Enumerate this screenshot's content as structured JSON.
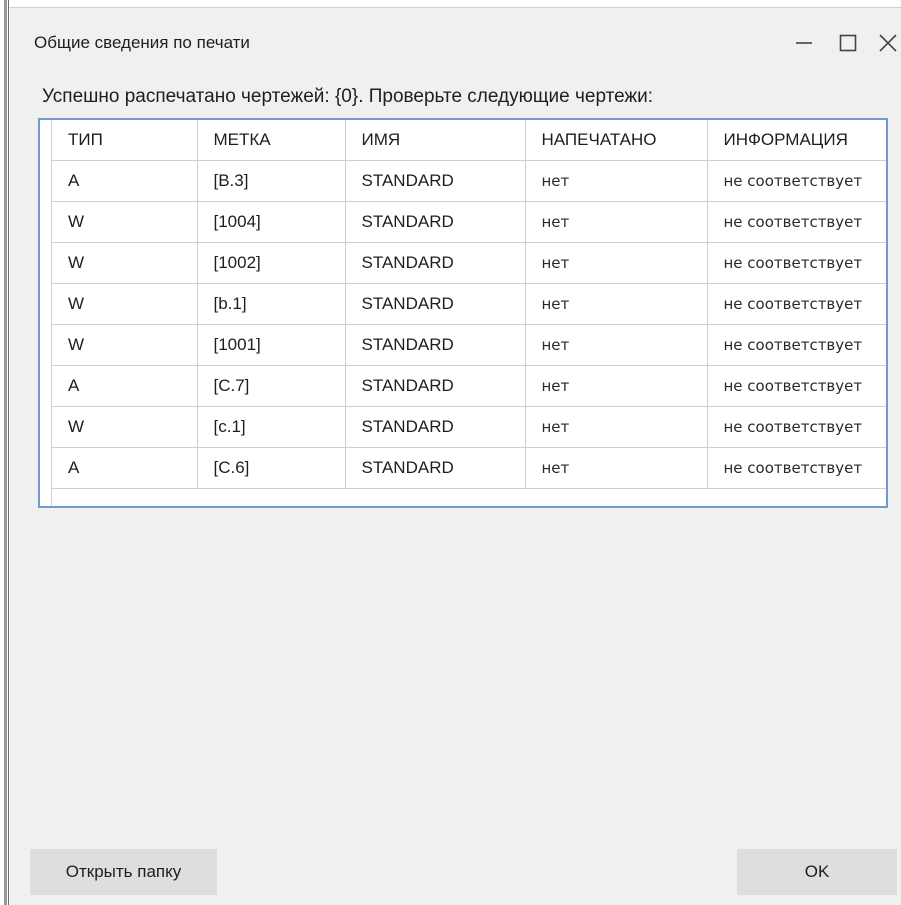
{
  "window": {
    "title": "Общие сведения по печати",
    "controls": {
      "minimize_icon": "minimize-icon",
      "maximize_icon": "maximize-icon",
      "close_icon": "close-icon"
    }
  },
  "summary_text": "Успешно распечатано чертежей: {0}. Проверьте следующие чертежи:",
  "table": {
    "columns": [
      "ТИП",
      "МЕТКА",
      "ИМЯ",
      "НАПЕЧАТАНО",
      "ИНФОРМАЦИЯ"
    ],
    "rows": [
      [
        "A",
        "[B.3]",
        "STANDARD",
        "нет",
        "не соответствует"
      ],
      [
        "W",
        "[1004]",
        "STANDARD",
        "нет",
        "не соответствует"
      ],
      [
        "W",
        "[1002]",
        "STANDARD",
        "нет",
        "не соответствует"
      ],
      [
        "W",
        "[b.1]",
        "STANDARD",
        "нет",
        "не соответствует"
      ],
      [
        "W",
        "[1001]",
        "STANDARD",
        "нет",
        "не соответствует"
      ],
      [
        "A",
        "[C.7]",
        "STANDARD",
        "нет",
        "не соответствует"
      ],
      [
        "W",
        "[c.1]",
        "STANDARD",
        "нет",
        "не соответствует"
      ],
      [
        "A",
        "[C.6]",
        "STANDARD",
        "нет",
        "не соответствует"
      ]
    ]
  },
  "buttons": {
    "open_folder": "Открыть папку",
    "ok": "OK"
  },
  "colors": {
    "dialog_background": "#f0f0f0",
    "grid_border": "#6f9bd1",
    "button_background": "#dedede"
  }
}
